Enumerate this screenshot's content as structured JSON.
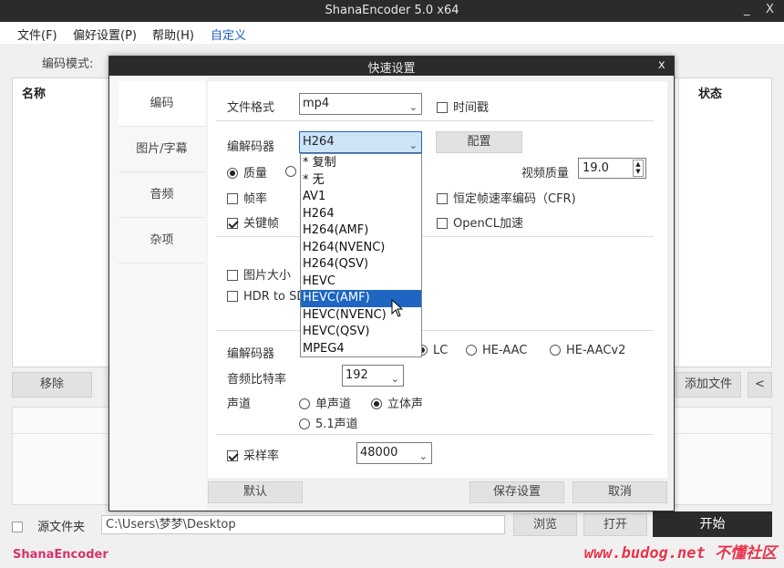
{
  "app": {
    "title": "ShanaEncoder 5.0 x64",
    "minimize": "_",
    "close": "X",
    "menus": [
      "文件(F)",
      "偏好设置(P)",
      "帮助(H)",
      "自定义"
    ],
    "toolbar_label": "编码模式:",
    "list_header_name": "名称",
    "list_header_status": "状态",
    "remove_button": "移除",
    "add_file_button": "添加文件",
    "prev_button": "<",
    "source_folder_label": "源文件夹",
    "source_path": "C:\\Users\\梦梦\\Desktop",
    "browse_button": "浏览",
    "open_button": "打开",
    "start_button": "开始",
    "brand": "ShanaEncoder",
    "watermark": "www.budog.net 不懂社区"
  },
  "dialog": {
    "title": "快速设置",
    "close": "x",
    "tabs": [
      "编码",
      "图片/字幕",
      "音频",
      "杂项"
    ],
    "active_tab_index": 0,
    "file_format_label": "文件格式",
    "file_format_value": "mp4",
    "timestamp_label": "时间戳",
    "codec_label": "编解码器",
    "codec_value": "H264",
    "config_button": "配置",
    "quality_label": "质量",
    "video_quality_label": "视频质量",
    "video_quality_value": "19.0",
    "framerate_label": "帧率",
    "cfr_label": "恒定帧速率编码（CFR)",
    "keyframe_label": "关键帧",
    "opencl_label": "OpenCL加速",
    "image_size_label": "图片大小",
    "hdr_label": "HDR to SD",
    "audio_codec_label": "编解码器",
    "aac_options": [
      "LC",
      "HE-AAC",
      "HE-AACv2"
    ],
    "audio_bitrate_label": "音频比特率",
    "audio_bitrate_value": "192",
    "channels_label": "声道",
    "mono_label": "单声道",
    "stereo_label": "立体声",
    "surround_label": "5.1声道",
    "samplerate_label": "采样率",
    "samplerate_value": "48000",
    "default_button": "默认",
    "save_button": "保存设置",
    "cancel_button": "取消",
    "codec_options": [
      "* 复制",
      "* 无",
      "AV1",
      "H264",
      "H264(AMF)",
      "H264(NVENC)",
      "H264(QSV)",
      "HEVC",
      "HEVC(AMF)",
      "HEVC(NVENC)",
      "HEVC(QSV)",
      "MPEG4"
    ],
    "highlighted_option_index": 8,
    "colors": {
      "accent": "#1e66c2",
      "titlebar": "#2b2b2b",
      "start_button": "#2b2b2b"
    }
  }
}
